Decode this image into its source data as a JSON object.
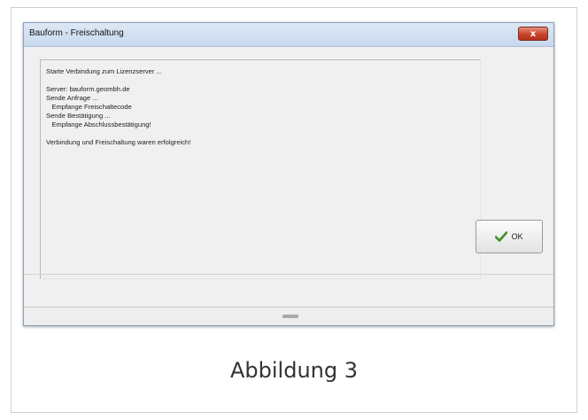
{
  "background": {
    "fragment_top": "-",
    "fragment_bottom": "t"
  },
  "dialog": {
    "title": "Bauform - Freischaltung",
    "close_label": "x",
    "log_text": "Starte Verbindung zum Lizenzserver ...\n\nServer: bauform.geombh.de\nSende Anfrage ...\n   Empfange Freischaltecode\nSende Bestätigung ...\n   Empfange Abschlussbestätigung!\n\nVerbindung und Freischaltung waren erfolgreich!",
    "ok_label": "OK",
    "ok_icon": "checkmark-icon"
  },
  "caption": "Abbildung 3",
  "colors": {
    "titlebar": "#c8d9ee",
    "close_button": "#c9442a",
    "checkmark": "#3f8f2a",
    "dialog_bg": "#f0f0f0"
  }
}
